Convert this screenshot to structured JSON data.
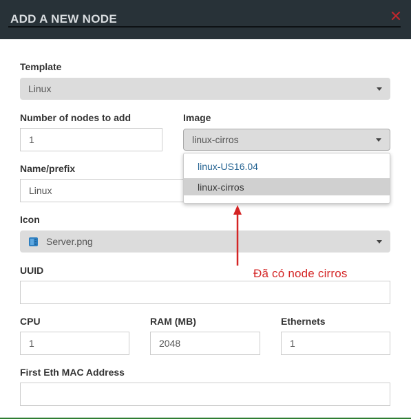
{
  "dialog": {
    "title": "ADD A NEW NODE",
    "close_icon": "close-x-icon"
  },
  "form": {
    "template": {
      "label": "Template",
      "value": "Linux"
    },
    "nodes": {
      "label": "Number of nodes to add",
      "value": "1"
    },
    "image": {
      "label": "Image",
      "value": "linux-cirros",
      "options": [
        "linux-US16.04",
        "linux-cirros"
      ],
      "highlighted_option": "linux-cirros"
    },
    "name_prefix": {
      "label": "Name/prefix",
      "value": "Linux"
    },
    "icon": {
      "label": "Icon",
      "value": "Server.png",
      "icon": "server-icon"
    },
    "uuid": {
      "label": "UUID",
      "value": ""
    },
    "cpu": {
      "label": "CPU",
      "value": "1"
    },
    "ram": {
      "label": "RAM (MB)",
      "value": "2048"
    },
    "ethernets": {
      "label": "Ethernets",
      "value": "1"
    },
    "first_eth_mac": {
      "label": "First Eth MAC Address",
      "value": ""
    }
  },
  "annotation": {
    "text": "Đã có node cirros",
    "color": "#d42424"
  },
  "colors": {
    "header_bg": "#283238",
    "select_bg": "#dcdcdc",
    "link": "#1f5f8f"
  }
}
